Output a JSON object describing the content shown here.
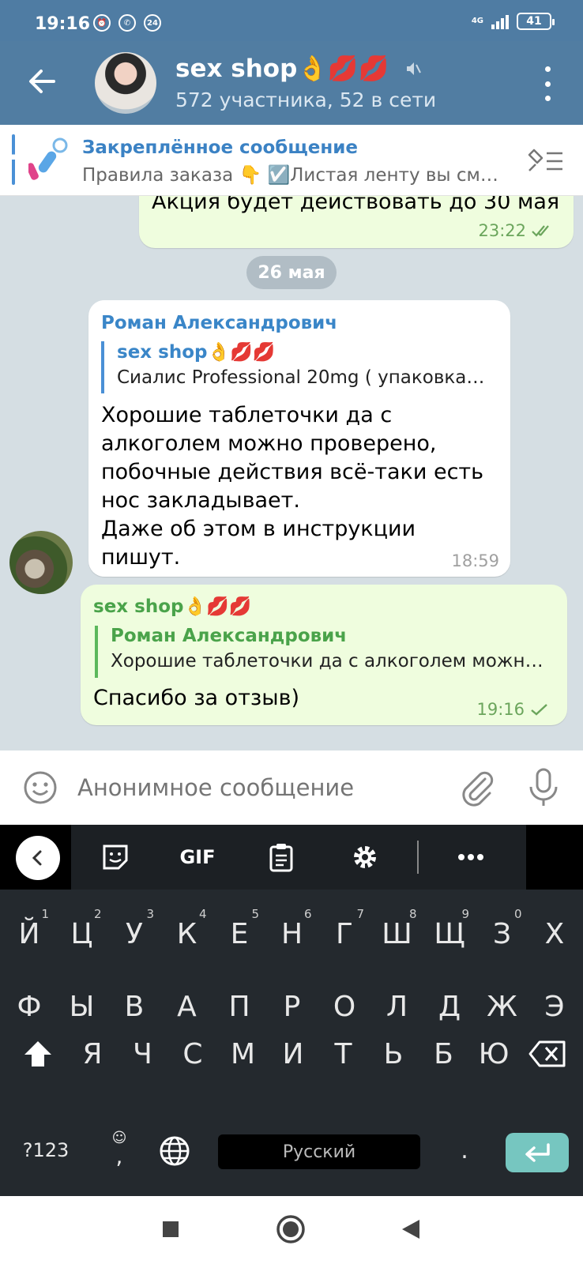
{
  "status": {
    "time": "19:16",
    "network": "4G",
    "battery": "41",
    "badge": "24"
  },
  "chat": {
    "title": "sex shop👌💋💋",
    "subtitle": "572 участника, 52 в сети"
  },
  "pinned": {
    "title": "Закреплённое сообщение",
    "text": "Правила заказа 👇 ☑️Листая ленту вы см…"
  },
  "messages": {
    "m1": {
      "text": "Акция будет действовать до 30 мая",
      "time": "23:22"
    },
    "date": "26 мая",
    "m2": {
      "sender": "Роман Александрович",
      "reply_name": "sex shop👌💋💋",
      "reply_text": "Сиалис Professional 20mg ( упаковка…",
      "lines": [
        "Хорошие таблеточки да с",
        "алкоголем можно проверено,",
        "побочные действия всё-таки есть",
        "нос закладывает.",
        "Даже об этом в инструкции",
        "пишут."
      ],
      "time": "18:59"
    },
    "m3": {
      "sender": "sex shop👌💋💋",
      "reply_name": "Роман Александрович",
      "reply_text": "Хорошие таблеточки да с алкоголем можн…",
      "text": "Спасибо за отзыв)",
      "time": "19:16"
    }
  },
  "composer": {
    "placeholder": "Анонимное сообщение"
  },
  "keyboard": {
    "toolbar": {
      "gif": "GIF"
    },
    "row1": [
      {
        "k": "Й",
        "s": "1"
      },
      {
        "k": "Ц",
        "s": "2"
      },
      {
        "k": "У",
        "s": "3"
      },
      {
        "k": "К",
        "s": "4"
      },
      {
        "k": "Е",
        "s": "5"
      },
      {
        "k": "Н",
        "s": "6"
      },
      {
        "k": "Г",
        "s": "7"
      },
      {
        "k": "Ш",
        "s": "8"
      },
      {
        "k": "Щ",
        "s": "9"
      },
      {
        "k": "З",
        "s": "0"
      },
      {
        "k": "Х",
        "s": ""
      }
    ],
    "row2": [
      "Ф",
      "Ы",
      "В",
      "А",
      "П",
      "Р",
      "О",
      "Л",
      "Д",
      "Ж",
      "Э"
    ],
    "row3": [
      "Я",
      "Ч",
      "С",
      "М",
      "И",
      "Т",
      "Ь",
      "Б",
      "Ю"
    ],
    "symbols": "?123",
    "comma": ",",
    "space": "Русский",
    "period": "."
  },
  "colors": {
    "header": "#517da2",
    "outgoing": "#effdde",
    "incoming": "#ffffff",
    "chat_bg": "#d5dee3",
    "keyboard": "#24292e",
    "enter": "#76c6c0"
  }
}
